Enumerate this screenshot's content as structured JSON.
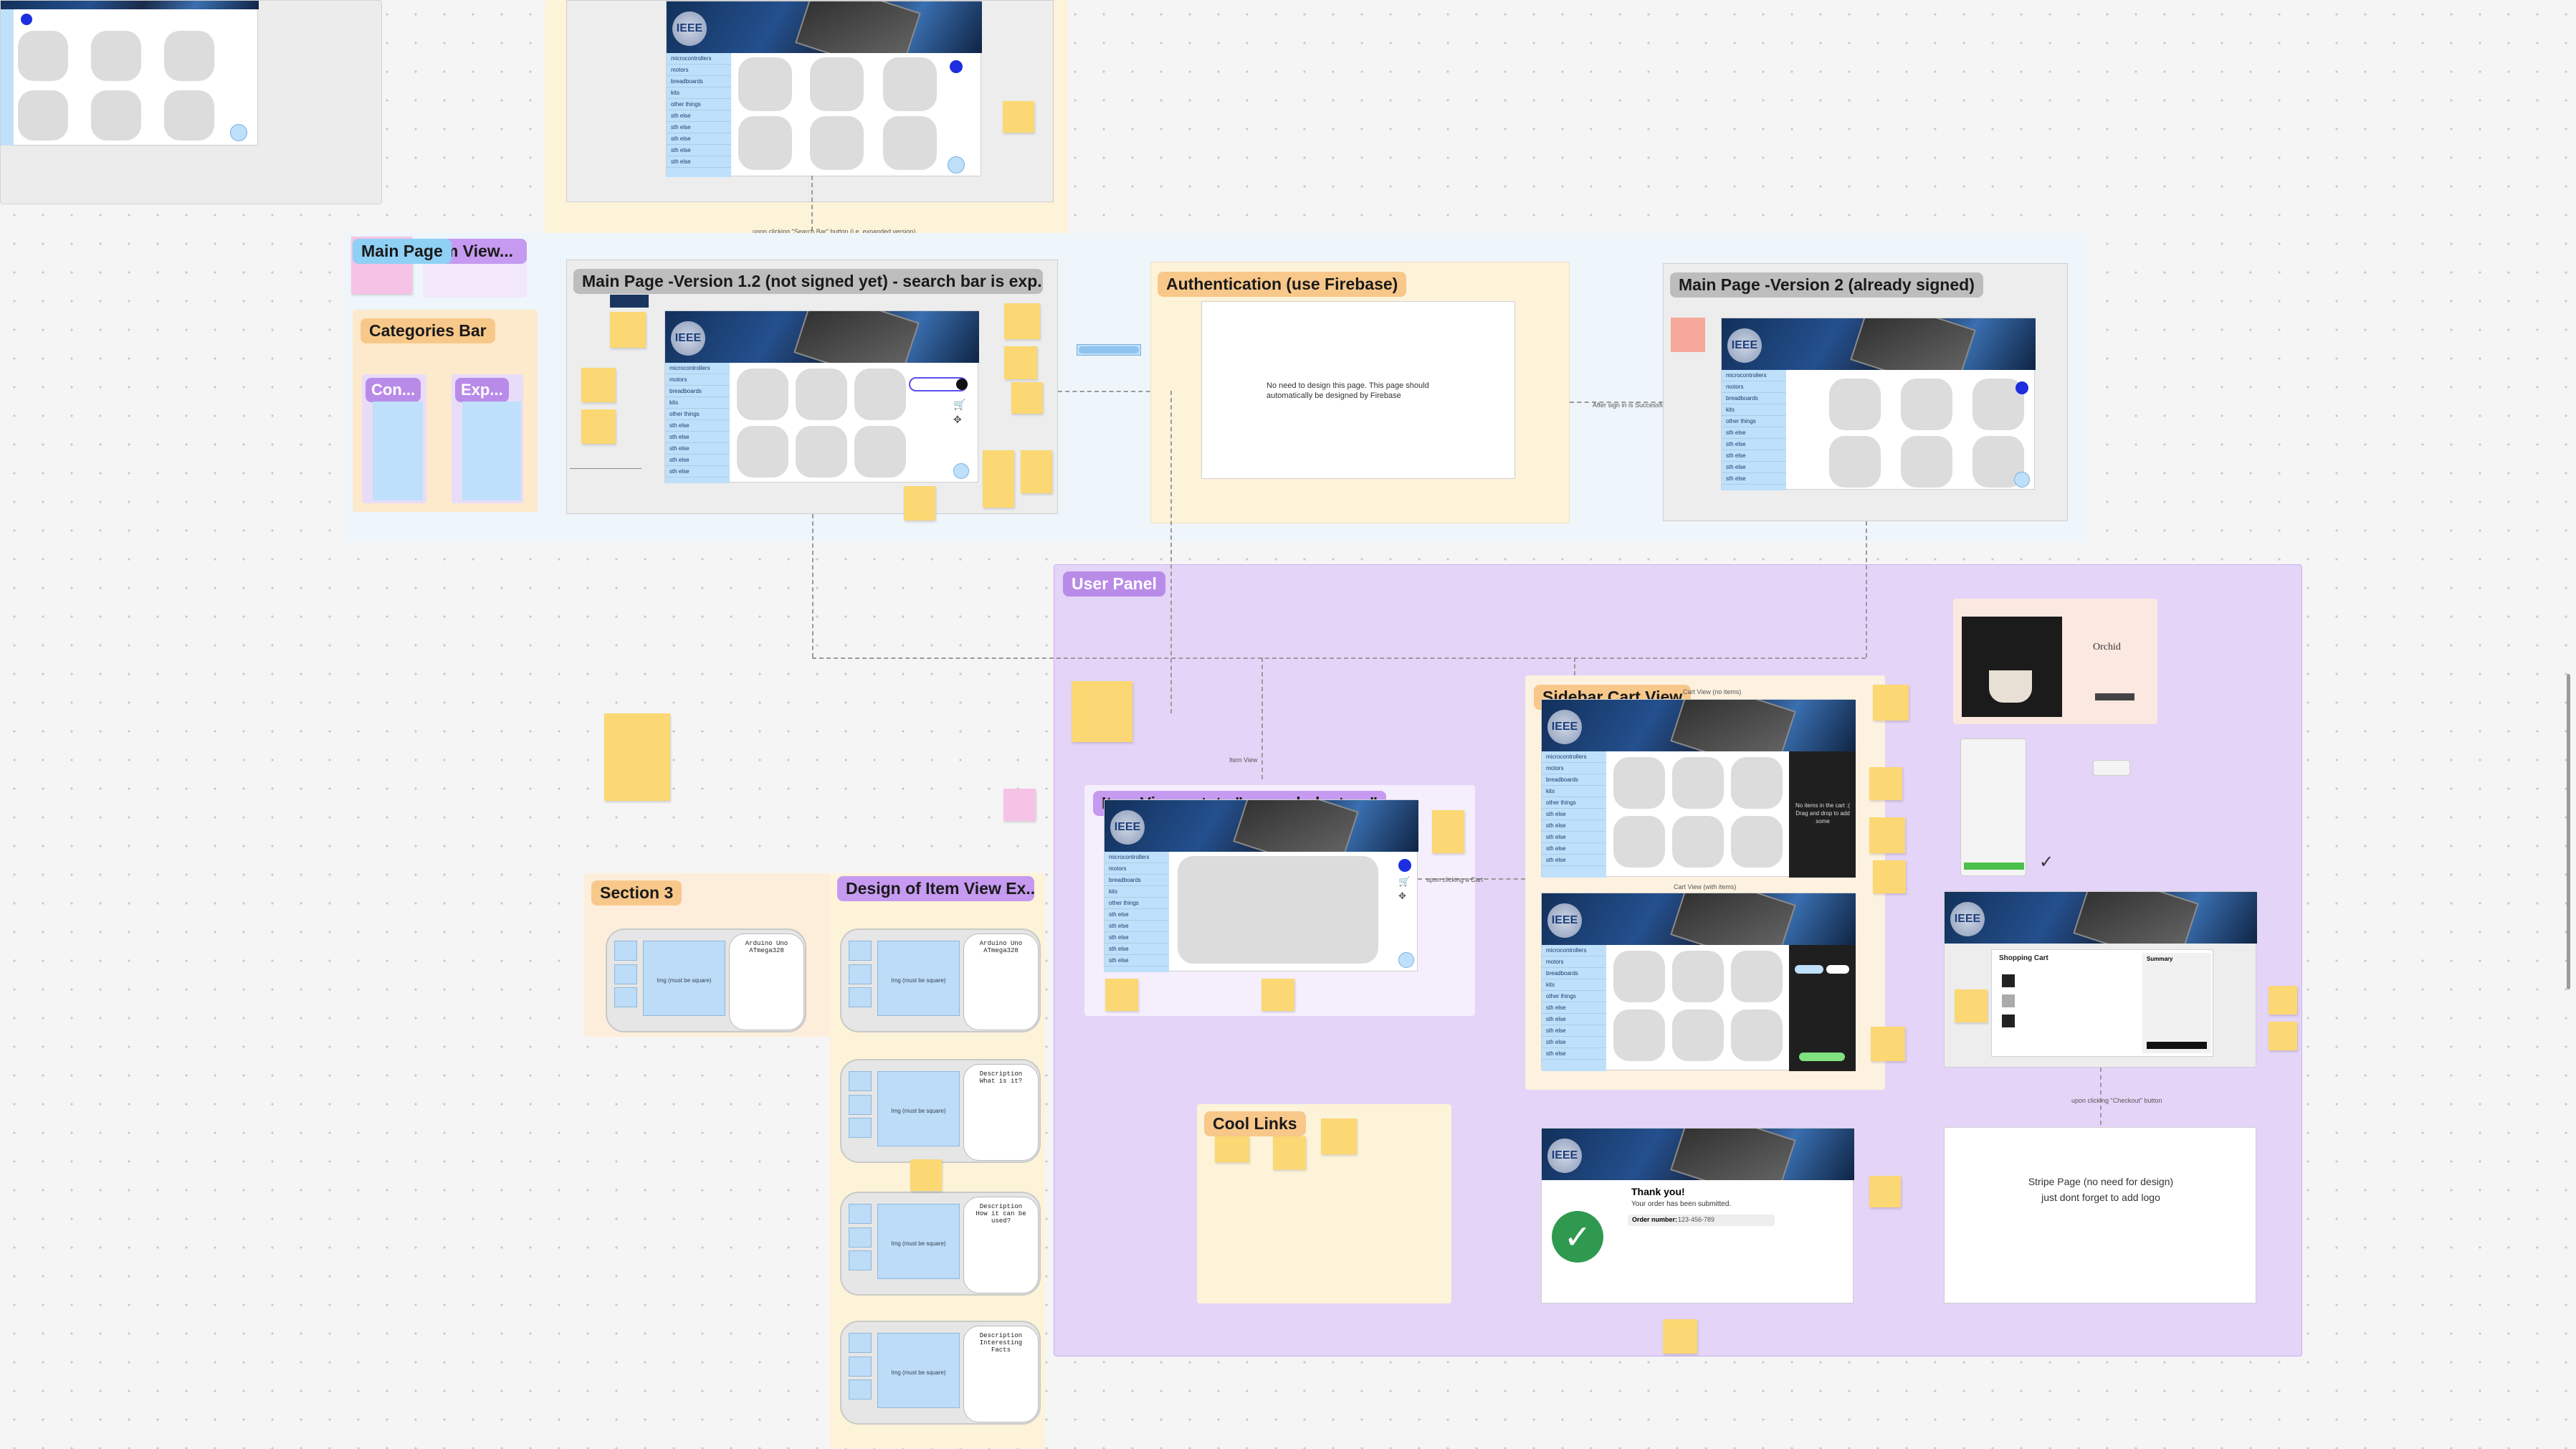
{
  "labels": {
    "main_page_tag": "Main Page",
    "item_view_tag": "Item View...",
    "categories_bar": "Categories Bar",
    "con": "Con...",
    "exp": "Exp...",
    "main_v12": "Main Page -Version 1.2 (not signed yet) - search bar is exp...",
    "authentication": "Authentication (use Firebase)",
    "main_v2": "Main Page -Version 2 (already signed)",
    "user_panel": "User Panel",
    "sidebar_cart_view": "Sidebar Cart View",
    "item_view_expanded": "Item View - state \"expanded = true\"",
    "section3": "Section 3",
    "design_item_view": "Design of Item View Ex...",
    "cool_links": "Cool Links"
  },
  "brand": {
    "logo_text": "IEEE"
  },
  "categories": [
    "microcontrollers",
    "motors",
    "breadboards",
    "kits",
    "other things",
    "sth else",
    "sth else",
    "sth else",
    "sth else",
    "sth else"
  ],
  "auth": {
    "note": "No need to design this page. This page should automatically be designed by Firebase"
  },
  "stripe": {
    "line1": "Stripe Page (no need for design)",
    "line2": "just dont forget to add logo"
  },
  "confirmation": {
    "thank_you": "Thank you!",
    "submitted": "Your order has been submitted.",
    "order_label": "Order number:",
    "order_number": "123-456-789"
  },
  "cart": {
    "empty_caption": "Cart View (no items)",
    "with_items_caption": "Cart View (with items)",
    "drag_hint": "No items in the cart :( Drag and drop to add some",
    "shopping_cart_title": "Shopping Cart",
    "summary_title": "Summary"
  },
  "orchid": {
    "title": "Orchid"
  },
  "item_design": {
    "title": "Arduino Uno",
    "subtitle": "ATmega328",
    "img_caption": "Img\n(must be square)",
    "desc_title": "Description",
    "q1": "What is it?",
    "q2": "How it can be used?",
    "q3": "Interesting Facts"
  },
  "connectors": {
    "search_click": "upon clicking \"Search Bar\" button (i.e. expanded version)",
    "sign_in": "After sign in is Successful",
    "upon_click_cart": "upon clicking a Cart",
    "item_view": "Item View",
    "stripe_click": "upon clicking \"Checkout\" button"
  },
  "colors": {
    "accent_blue": "#1d2ee0",
    "sidebar_blue": "#bfe0fa",
    "sticky_yellow": "#fbd873",
    "user_panel_bg": "#e4d4f8"
  }
}
